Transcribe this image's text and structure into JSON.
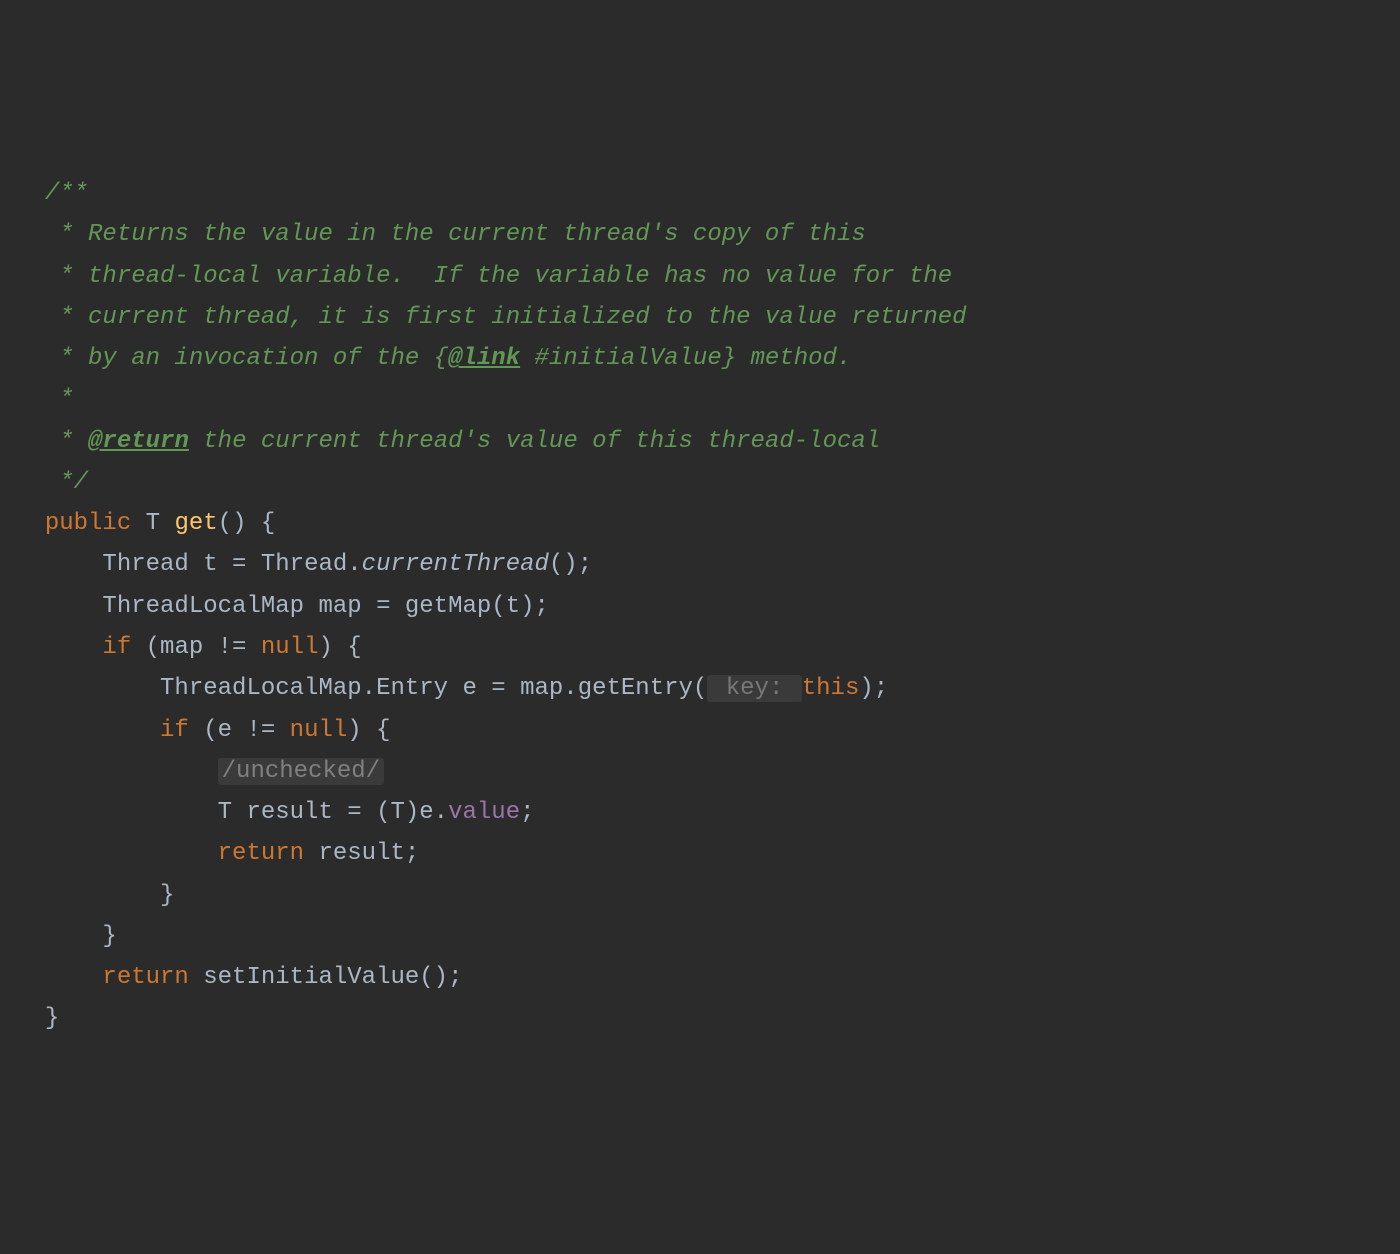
{
  "code": {
    "comment_open": "/**",
    "comment_l1": " * Returns the value in the current thread's copy of this",
    "comment_l2": " * thread-local variable.  If the variable has no value for the",
    "comment_l3": " * current thread, it is first initialized to the value returned",
    "comment_l4_a": " * by an invocation of the {",
    "comment_l4_link": "@link",
    "comment_l4_b": " #initialValue} method.",
    "comment_l5": " *",
    "comment_l6_a": " * ",
    "comment_l6_return": "@return",
    "comment_l6_b": " the current thread's value of this thread-local",
    "comment_close": " */",
    "kw_public": "public",
    "type_T": "T",
    "method_get": "get",
    "parens_open": "() {",
    "type_Thread": "Thread",
    "var_t": " t = Thread.",
    "method_currentThread": "currentThread",
    "call_end": "();",
    "type_ThreadLocalMap": "ThreadLocalMap",
    "var_map": " map = getMap(t);",
    "kw_if": "if",
    "cond_map_a": " (map != ",
    "kw_null": "null",
    "cond_close": ") {",
    "type_Entry": "ThreadLocalMap.Entry",
    "var_e_a": " e = map.getEntry(",
    "hint_key": " key: ",
    "kw_this": "this",
    "call_close": ");",
    "cond_e_a": " (e != ",
    "folded_unchecked": "/unchecked/",
    "result_a": " result = (T)e.",
    "field_value": "value",
    "semicolon": ";",
    "kw_return": "return",
    "return_result": " result;",
    "brace_close": "}",
    "return_setInitial": " setInitialValue();"
  }
}
